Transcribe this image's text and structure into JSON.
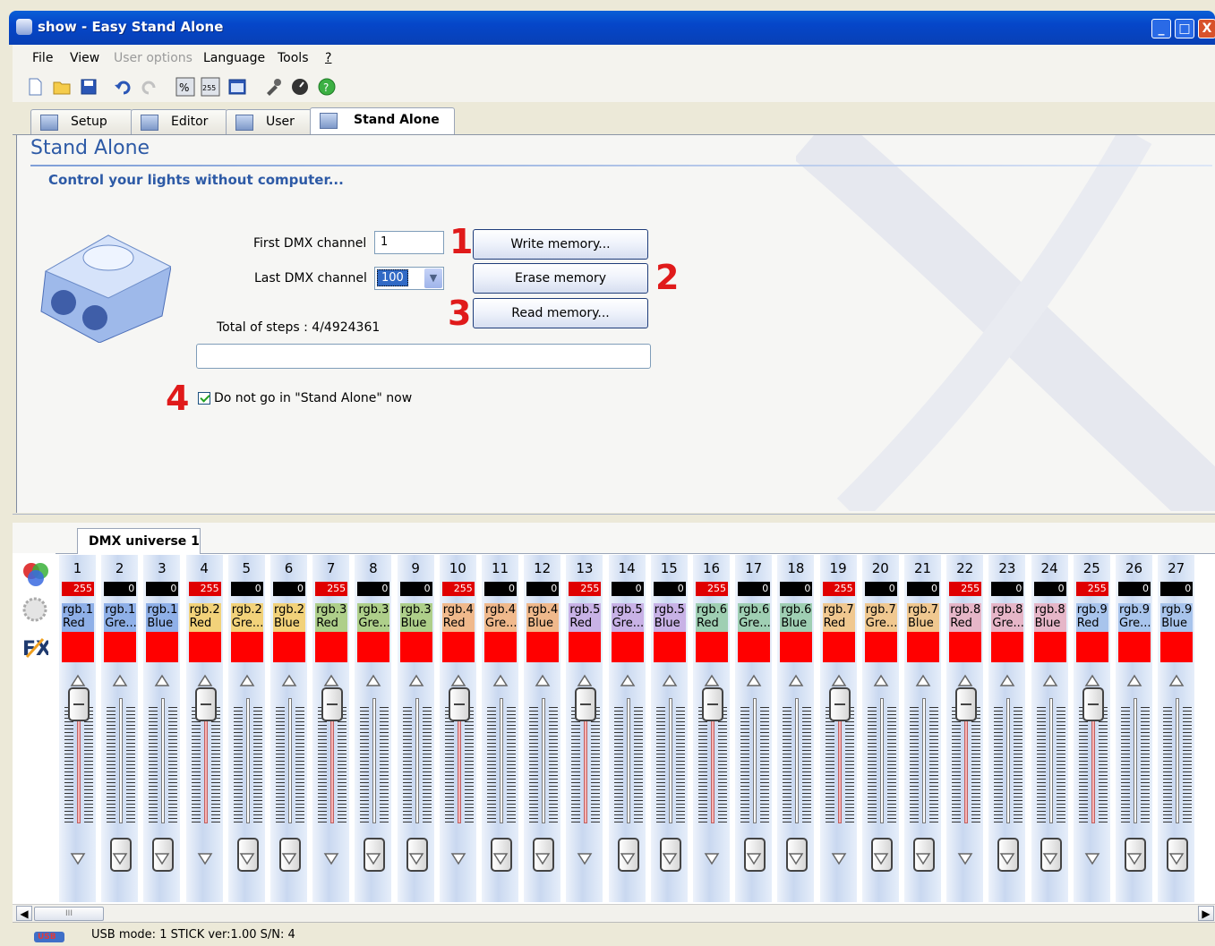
{
  "window": {
    "title": "show - Easy Stand Alone",
    "min": "_",
    "max": "□",
    "close": "X"
  },
  "menu": [
    "File",
    "View",
    "User options",
    "Language",
    "Tools",
    "?"
  ],
  "tabs": [
    "Setup",
    "Editor",
    "User",
    "Stand Alone"
  ],
  "panel": {
    "title": "Stand Alone",
    "subtitle": "Control your lights without computer...",
    "first_label": "First DMX channel",
    "first_value": "1",
    "last_label": "Last DMX channel",
    "last_value": "100",
    "write_btn": "Write memory...",
    "erase_btn": "Erase memory",
    "read_btn": "Read memory...",
    "total_steps": "Total of steps : 4/4924361",
    "checkbox_label": "Do not go in \"Stand Alone\" now",
    "n1": "1",
    "n2": "2",
    "n3": "3",
    "n4": "4"
  },
  "universe_tab": "DMX universe 1",
  "channels": [
    {
      "n": "1",
      "v": "255",
      "l1": "rgb.1",
      "l2": "Red",
      "c": "#8fb0e8",
      "pos": "top"
    },
    {
      "n": "2",
      "v": "0",
      "l1": "rgb.1",
      "l2": "Gre...",
      "c": "#8fb0e8",
      "pos": "bottom"
    },
    {
      "n": "3",
      "v": "0",
      "l1": "rgb.1",
      "l2": "Blue",
      "c": "#8fb0e8",
      "pos": "bottom"
    },
    {
      "n": "4",
      "v": "255",
      "l1": "rgb.2",
      "l2": "Red",
      "c": "#f2d27a",
      "pos": "top"
    },
    {
      "n": "5",
      "v": "0",
      "l1": "rgb.2",
      "l2": "Gre...",
      "c": "#f2d27a",
      "pos": "bottom"
    },
    {
      "n": "6",
      "v": "0",
      "l1": "rgb.2",
      "l2": "Blue",
      "c": "#f2d27a",
      "pos": "bottom"
    },
    {
      "n": "7",
      "v": "255",
      "l1": "rgb.3",
      "l2": "Red",
      "c": "#aecf8a",
      "pos": "top"
    },
    {
      "n": "8",
      "v": "0",
      "l1": "rgb.3",
      "l2": "Gre...",
      "c": "#aecf8a",
      "pos": "bottom"
    },
    {
      "n": "9",
      "v": "0",
      "l1": "rgb.3",
      "l2": "Blue",
      "c": "#aecf8a",
      "pos": "bottom"
    },
    {
      "n": "10",
      "v": "255",
      "l1": "rgb.4",
      "l2": "Red",
      "c": "#f0b98c",
      "pos": "top"
    },
    {
      "n": "11",
      "v": "0",
      "l1": "rgb.4",
      "l2": "Gre...",
      "c": "#f0b98c",
      "pos": "bottom"
    },
    {
      "n": "12",
      "v": "0",
      "l1": "rgb.4",
      "l2": "Blue",
      "c": "#f0b98c",
      "pos": "bottom"
    },
    {
      "n": "13",
      "v": "255",
      "l1": "rgb.5",
      "l2": "Red",
      "c": "#c8b2e6",
      "pos": "top"
    },
    {
      "n": "14",
      "v": "0",
      "l1": "rgb.5",
      "l2": "Gre...",
      "c": "#c8b2e6",
      "pos": "bottom"
    },
    {
      "n": "15",
      "v": "0",
      "l1": "rgb.5",
      "l2": "Blue",
      "c": "#c8b2e6",
      "pos": "bottom"
    },
    {
      "n": "16",
      "v": "255",
      "l1": "rgb.6",
      "l2": "Red",
      "c": "#9fcfb3",
      "pos": "top"
    },
    {
      "n": "17",
      "v": "0",
      "l1": "rgb.6",
      "l2": "Gre...",
      "c": "#9fcfb3",
      "pos": "bottom"
    },
    {
      "n": "18",
      "v": "0",
      "l1": "rgb.6",
      "l2": "Blue",
      "c": "#9fcfb3",
      "pos": "bottom"
    },
    {
      "n": "19",
      "v": "255",
      "l1": "rgb.7",
      "l2": "Red",
      "c": "#f0c890",
      "pos": "top"
    },
    {
      "n": "20",
      "v": "0",
      "l1": "rgb.7",
      "l2": "Gre...",
      "c": "#f0c890",
      "pos": "bottom"
    },
    {
      "n": "21",
      "v": "0",
      "l1": "rgb.7",
      "l2": "Blue",
      "c": "#f0c890",
      "pos": "bottom"
    },
    {
      "n": "22",
      "v": "255",
      "l1": "rgb.8",
      "l2": "Red",
      "c": "#e6b6c8",
      "pos": "top"
    },
    {
      "n": "23",
      "v": "0",
      "l1": "rgb.8",
      "l2": "Gre...",
      "c": "#e6b6c8",
      "pos": "bottom"
    },
    {
      "n": "24",
      "v": "0",
      "l1": "rgb.8",
      "l2": "Blue",
      "c": "#e6b6c8",
      "pos": "bottom"
    },
    {
      "n": "25",
      "v": "255",
      "l1": "rgb.9",
      "l2": "Red",
      "c": "#a8c4ec",
      "pos": "top"
    },
    {
      "n": "26",
      "v": "0",
      "l1": "rgb.9",
      "l2": "Gre...",
      "c": "#a8c4ec",
      "pos": "bottom"
    },
    {
      "n": "27",
      "v": "0",
      "l1": "rgb.9",
      "l2": "Blue",
      "c": "#a8c4ec",
      "pos": "bottom"
    }
  ],
  "scroll_thumb": "III",
  "status": "USB mode: 1 STICK  ver:1.00  S/N: 4",
  "usb_icon_label": "USB"
}
